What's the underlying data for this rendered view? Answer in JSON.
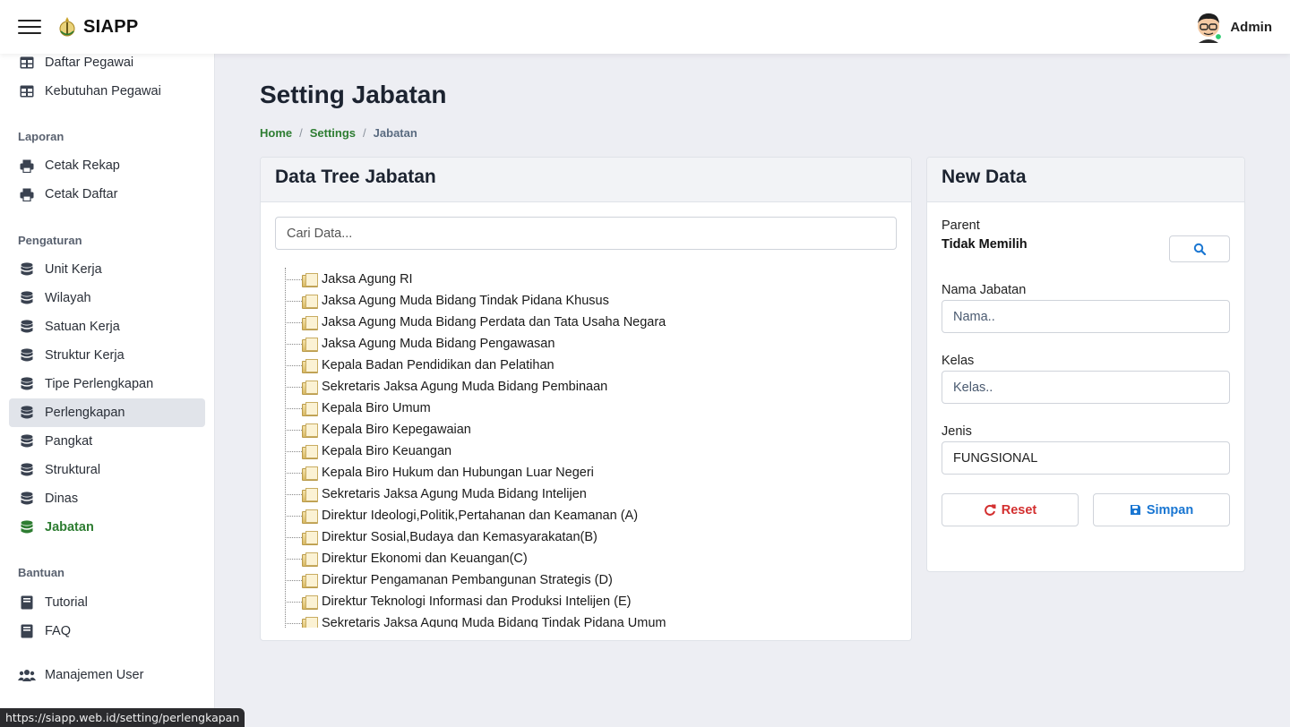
{
  "header": {
    "brand": "SIAPP",
    "user_name": "Admin"
  },
  "sidebar": {
    "top_items": [
      {
        "label": "Daftar Pegawai",
        "icon": "table-icon"
      },
      {
        "label": "Kebutuhan Pegawai",
        "icon": "table-icon"
      }
    ],
    "sections": {
      "laporan": "Laporan",
      "pengaturan": "Pengaturan",
      "bantuan": "Bantuan"
    },
    "laporan_items": [
      {
        "label": "Cetak Rekap",
        "icon": "printer-icon"
      },
      {
        "label": "Cetak Daftar",
        "icon": "printer-icon"
      }
    ],
    "pengaturan_items": [
      {
        "label": "Unit Kerja",
        "icon": "database-icon"
      },
      {
        "label": "Wilayah",
        "icon": "database-icon"
      },
      {
        "label": "Satuan Kerja",
        "icon": "database-icon"
      },
      {
        "label": "Struktur Kerja",
        "icon": "database-icon"
      },
      {
        "label": "Tipe Perlengkapan",
        "icon": "database-icon"
      },
      {
        "label": "Perlengkapan",
        "icon": "database-icon"
      },
      {
        "label": "Pangkat",
        "icon": "database-icon"
      },
      {
        "label": "Struktural",
        "icon": "database-icon"
      },
      {
        "label": "Dinas",
        "icon": "database-icon"
      },
      {
        "label": "Jabatan",
        "icon": "database-icon"
      }
    ],
    "bantuan_items": [
      {
        "label": "Tutorial",
        "icon": "book-icon"
      },
      {
        "label": "FAQ",
        "icon": "book-icon"
      }
    ],
    "manajemen_user": {
      "label": "Manajemen User",
      "icon": "users-icon"
    },
    "colors": {
      "active": "#2e7d32",
      "hover_bg": "#e1e4ea"
    }
  },
  "status_url": "https://siapp.web.id/setting/perlengkapan",
  "page": {
    "title": "Setting Jabatan",
    "breadcrumb": {
      "home": "Home",
      "settings": "Settings",
      "current": "Jabatan"
    }
  },
  "tree_card": {
    "title": "Data Tree Jabatan",
    "search_placeholder": "Cari Data...",
    "items": [
      "Jaksa Agung RI",
      "Jaksa Agung Muda Bidang Tindak Pidana Khusus",
      "Jaksa Agung Muda Bidang Perdata dan Tata Usaha Negara",
      "Jaksa Agung Muda Bidang Pengawasan",
      "Kepala Badan Pendidikan dan Pelatihan",
      "Sekretaris Jaksa Agung Muda Bidang Pembinaan",
      "Kepala Biro Umum",
      "Kepala Biro Kepegawaian",
      "Kepala Biro Keuangan",
      "Kepala Biro Hukum dan Hubungan Luar Negeri",
      "Sekretaris Jaksa Agung Muda Bidang Intelijen",
      "Direktur Ideologi,Politik,Pertahanan dan Keamanan (A)",
      "Direktur Sosial,Budaya dan Kemasyarakatan(B)",
      "Direktur Ekonomi dan Keuangan(C)",
      "Direktur Pengamanan Pembangunan Strategis (D)",
      "Direktur Teknologi Informasi dan Produksi Intelijen (E)",
      "Sekretaris Jaksa Agung Muda Bidang Tindak Pidana Umum"
    ]
  },
  "new_card": {
    "title": "New Data",
    "parent_label": "Parent",
    "parent_value": "Tidak Memilih",
    "nama_label": "Nama Jabatan",
    "nama_placeholder": "Nama..",
    "kelas_label": "Kelas",
    "kelas_placeholder": "Kelas..",
    "jenis_label": "Jenis",
    "jenis_value": "FUNGSIONAL",
    "reset_label": "Reset",
    "save_label": "Simpan",
    "colors": {
      "reset": "#d32f2f",
      "save": "#1976d2"
    }
  }
}
